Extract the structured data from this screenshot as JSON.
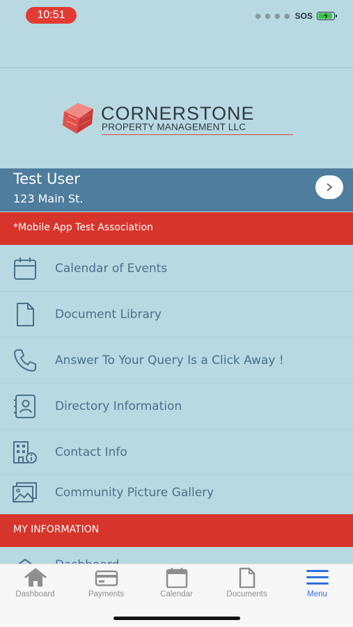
{
  "status_bar": {
    "time": "10:51",
    "carrier": "SOS",
    "battery_charging": true
  },
  "logo": {
    "name": "CORNERSTONE",
    "subtitle": "PROPERTY MANAGEMENT LLC"
  },
  "user": {
    "name": "Test User",
    "address": "123 Main St."
  },
  "association": "*Mobile App Test Association",
  "menu": [
    {
      "label": "Calendar of Events",
      "icon": "calendar-icon"
    },
    {
      "label": "Document Library",
      "icon": "document-icon"
    },
    {
      "label": "Answer To Your Query Is a Click Away !",
      "icon": "phone-icon"
    },
    {
      "label": "Directory Information",
      "icon": "contact-card-icon"
    },
    {
      "label": "Contact Info",
      "icon": "building-info-icon"
    },
    {
      "label": "Community Picture Gallery",
      "icon": "gallery-icon"
    }
  ],
  "section_header": "MY INFORMATION",
  "partial_item": {
    "label": "Dashboard",
    "icon": "home-icon"
  },
  "tabs": [
    {
      "label": "Dashboard",
      "icon": "home-icon",
      "active": false
    },
    {
      "label": "Payments",
      "icon": "credit-card-icon",
      "active": false
    },
    {
      "label": "Calendar",
      "icon": "calendar-icon",
      "active": false
    },
    {
      "label": "Documents",
      "icon": "document-icon",
      "active": false
    },
    {
      "label": "Menu",
      "icon": "hamburger-menu-icon",
      "active": true
    }
  ],
  "colors": {
    "background": "#b8d9e1",
    "user_bar": "#4f7d9d",
    "accent_red": "#d7342c",
    "tab_active": "#2f6fe0",
    "tab_inactive": "#8e8e8e"
  }
}
